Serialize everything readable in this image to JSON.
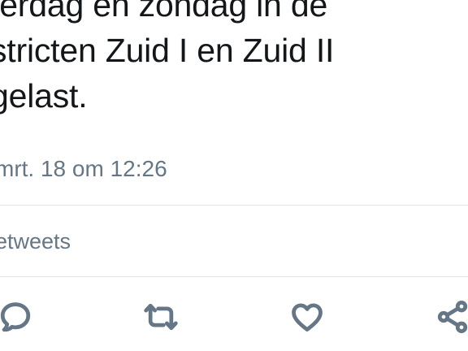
{
  "tweet": {
    "text_lines": [
      "terdag en zondag in de",
      "stricten Zuid I en Zuid II",
      "gelast."
    ],
    "timestamp": "mrt. 18 om 12:26"
  },
  "stats": {
    "retweets_label": "etweets"
  },
  "actions": {
    "reply_icon": "reply-icon",
    "retweet_icon": "retweet-icon",
    "like_icon": "heart-icon",
    "share_icon": "share-icon"
  },
  "colors": {
    "text": "#14171a",
    "secondary": "#657786",
    "divider": "#e1e8ed"
  }
}
